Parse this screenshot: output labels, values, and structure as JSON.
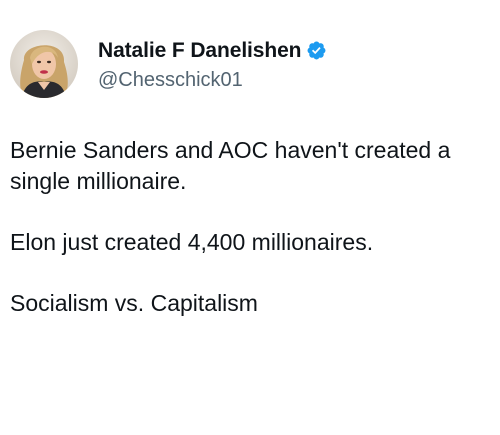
{
  "tweet": {
    "author": {
      "display_name": "Natalie F Danelishen",
      "handle": "@Chesschick01",
      "verified": true,
      "avatar_icon": "profile-photo",
      "verified_icon": "verified-badge-icon"
    },
    "paragraphs": [
      "Bernie Sanders and AOC haven't created a single millionaire.",
      "Elon just created 4,400 millionaires.",
      "Socialism vs. Capitalism"
    ]
  },
  "colors": {
    "background": "#ffffff",
    "text": "#0f1419",
    "secondary_text": "#536471",
    "verified_blue": "#1d9bf0"
  }
}
